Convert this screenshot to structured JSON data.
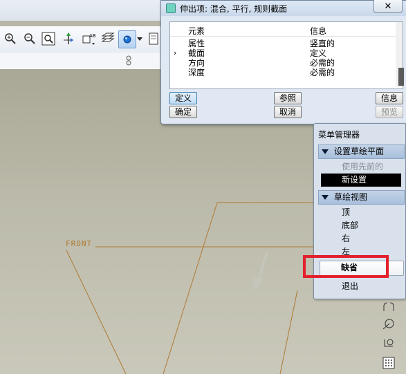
{
  "dialog": {
    "title": "伸出项: 混合, 平行, 规则截面",
    "close_symbol": "✕",
    "columns": {
      "element": "元素",
      "info": "信息"
    },
    "rows": [
      {
        "element": "属性",
        "info": "竖直的",
        "current": false
      },
      {
        "element": "截面",
        "info": "定义",
        "current": true
      },
      {
        "element": "方向",
        "info": "必需的",
        "current": false
      },
      {
        "element": "深度",
        "info": "必需的",
        "current": false
      }
    ],
    "current_marker": "›",
    "buttons": {
      "define": "定义",
      "ok": "确定",
      "refs": "参照",
      "cancel": "取消",
      "info": "信息",
      "preview": "预览"
    }
  },
  "menu_manager": {
    "title": "菜单管理器",
    "section1": {
      "label": "设置草绘平面",
      "items": [
        {
          "label": "使用先前的",
          "state": "disabled"
        },
        {
          "label": "新设置",
          "state": "selected"
        }
      ]
    },
    "section2": {
      "label": "草绘视图",
      "items": [
        {
          "label": "顶",
          "state": "normal"
        },
        {
          "label": "底部",
          "state": "normal"
        },
        {
          "label": "右",
          "state": "normal"
        },
        {
          "label": "左",
          "state": "normal"
        },
        {
          "label": "缺省",
          "state": "highlighted"
        },
        {
          "label": "退出",
          "state": "normal"
        }
      ]
    }
  },
  "canvas": {
    "datum_label": "FRONT"
  },
  "toolbar": {
    "icons": [
      "zoom-in-icon",
      "zoom-out-icon",
      "refit-icon",
      "spin-center-icon",
      "named-view-icon",
      "layers-icon",
      "display-style-icon",
      "dropdown-icon",
      "appearance-icon"
    ]
  },
  "colors": {
    "sketch_line": "#b07830",
    "highlight_box": "#e3202c",
    "selected_item": "#000000",
    "section_header": "#b0c5df"
  }
}
